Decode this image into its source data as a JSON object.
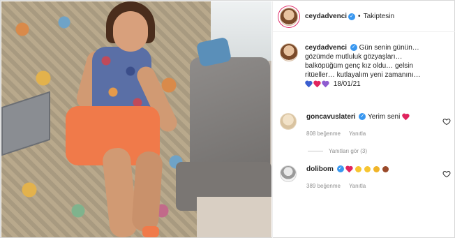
{
  "post": {
    "photo_alt": "photo"
  },
  "header": {
    "username": "ceydadvenci",
    "verified_mark": "✓",
    "separator": "•",
    "follow_status": "Takiptesin"
  },
  "caption": {
    "username": "ceydadvenci",
    "verified_mark": "✓",
    "line1": "Gün senin günün…",
    "line2": "gözümde mutluluk gözyaşları…",
    "line3": "balköpüğüm genç kız oldu… gelsin",
    "line4": "ritüeller… kutlayalım yeni zamanını…",
    "hearts": [
      "#3b5fd0",
      "#e0245e",
      "#8e5cd0"
    ],
    "date": "18/01/21"
  },
  "comments": [
    {
      "username": "goncavuslateri",
      "verified_mark": "✓",
      "text": "Yerim seni",
      "likes": "808 beğenme",
      "reply": "Yanıtla"
    },
    {
      "username": "dolibom",
      "verified_mark": "✓",
      "text": "",
      "likes": "389 beğenme",
      "reply": "Yanıtla"
    }
  ],
  "replies_toggle": "Yanıtları gör (3)",
  "colors": {
    "verified": "#3897f0",
    "heart_red": "#e0245e",
    "muted": "#8e8e8e"
  }
}
